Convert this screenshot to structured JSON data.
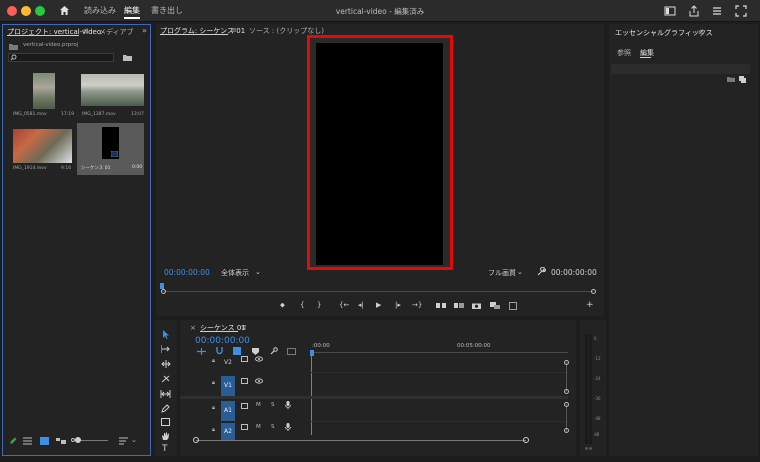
{
  "titlebar": {
    "tabs": {
      "import": "読み込み",
      "edit": "編集",
      "export": "書き出し"
    },
    "doc_title": "vertical-video - 編集済み",
    "colors": {
      "close": "#fe5f57",
      "minimize": "#febc2e",
      "maximize": "#28c840"
    }
  },
  "project": {
    "tab_label": "プロジェクト: vertical-video",
    "media_tab_label": "メディアブ",
    "file_name": "vertical-video.prproj",
    "clips": [
      {
        "name": "IMG_0581.mov",
        "duration": "17:19"
      },
      {
        "name": "IMG_1387.mov",
        "duration": "13:07"
      },
      {
        "name": "IMG_1914.mov",
        "duration": "9:16"
      },
      {
        "name": "シーケンス 01",
        "duration": "0:00"
      }
    ]
  },
  "program": {
    "tab_label": "プログラム: シーケンス 01",
    "source_label": "ソース : (クリップなし)",
    "timecode_left": "00:00:00:00",
    "fit": "全体表示",
    "quality": "フル画質",
    "timecode_right": "00:00:00:00",
    "controls": {
      "marker": "⬥",
      "in": "{",
      "out": "}",
      "prev": "{←",
      "step_back": "◂|",
      "play": "▶",
      "step_fwd": "|▸",
      "next": "→}",
      "add": "+"
    }
  },
  "essential_graphics": {
    "title": "エッセンシャルグラフィックス",
    "tabs": {
      "browse": "参照",
      "edit": "編集"
    }
  },
  "timeline": {
    "tab_label": "シーケンス 01",
    "timecode": "00:00:00:00",
    "ruler": {
      "start": ":00:00",
      "mid": "00:05:00:00"
    },
    "tracks": [
      {
        "name": "V2"
      },
      {
        "name": "V1"
      },
      {
        "name": "A1",
        "m": "M",
        "s": "S"
      },
      {
        "name": "A2",
        "m": "M",
        "s": "S"
      }
    ]
  },
  "meter": {
    "labels": [
      "0",
      "-12",
      "-24",
      "-36",
      "-48",
      "dB"
    ]
  }
}
